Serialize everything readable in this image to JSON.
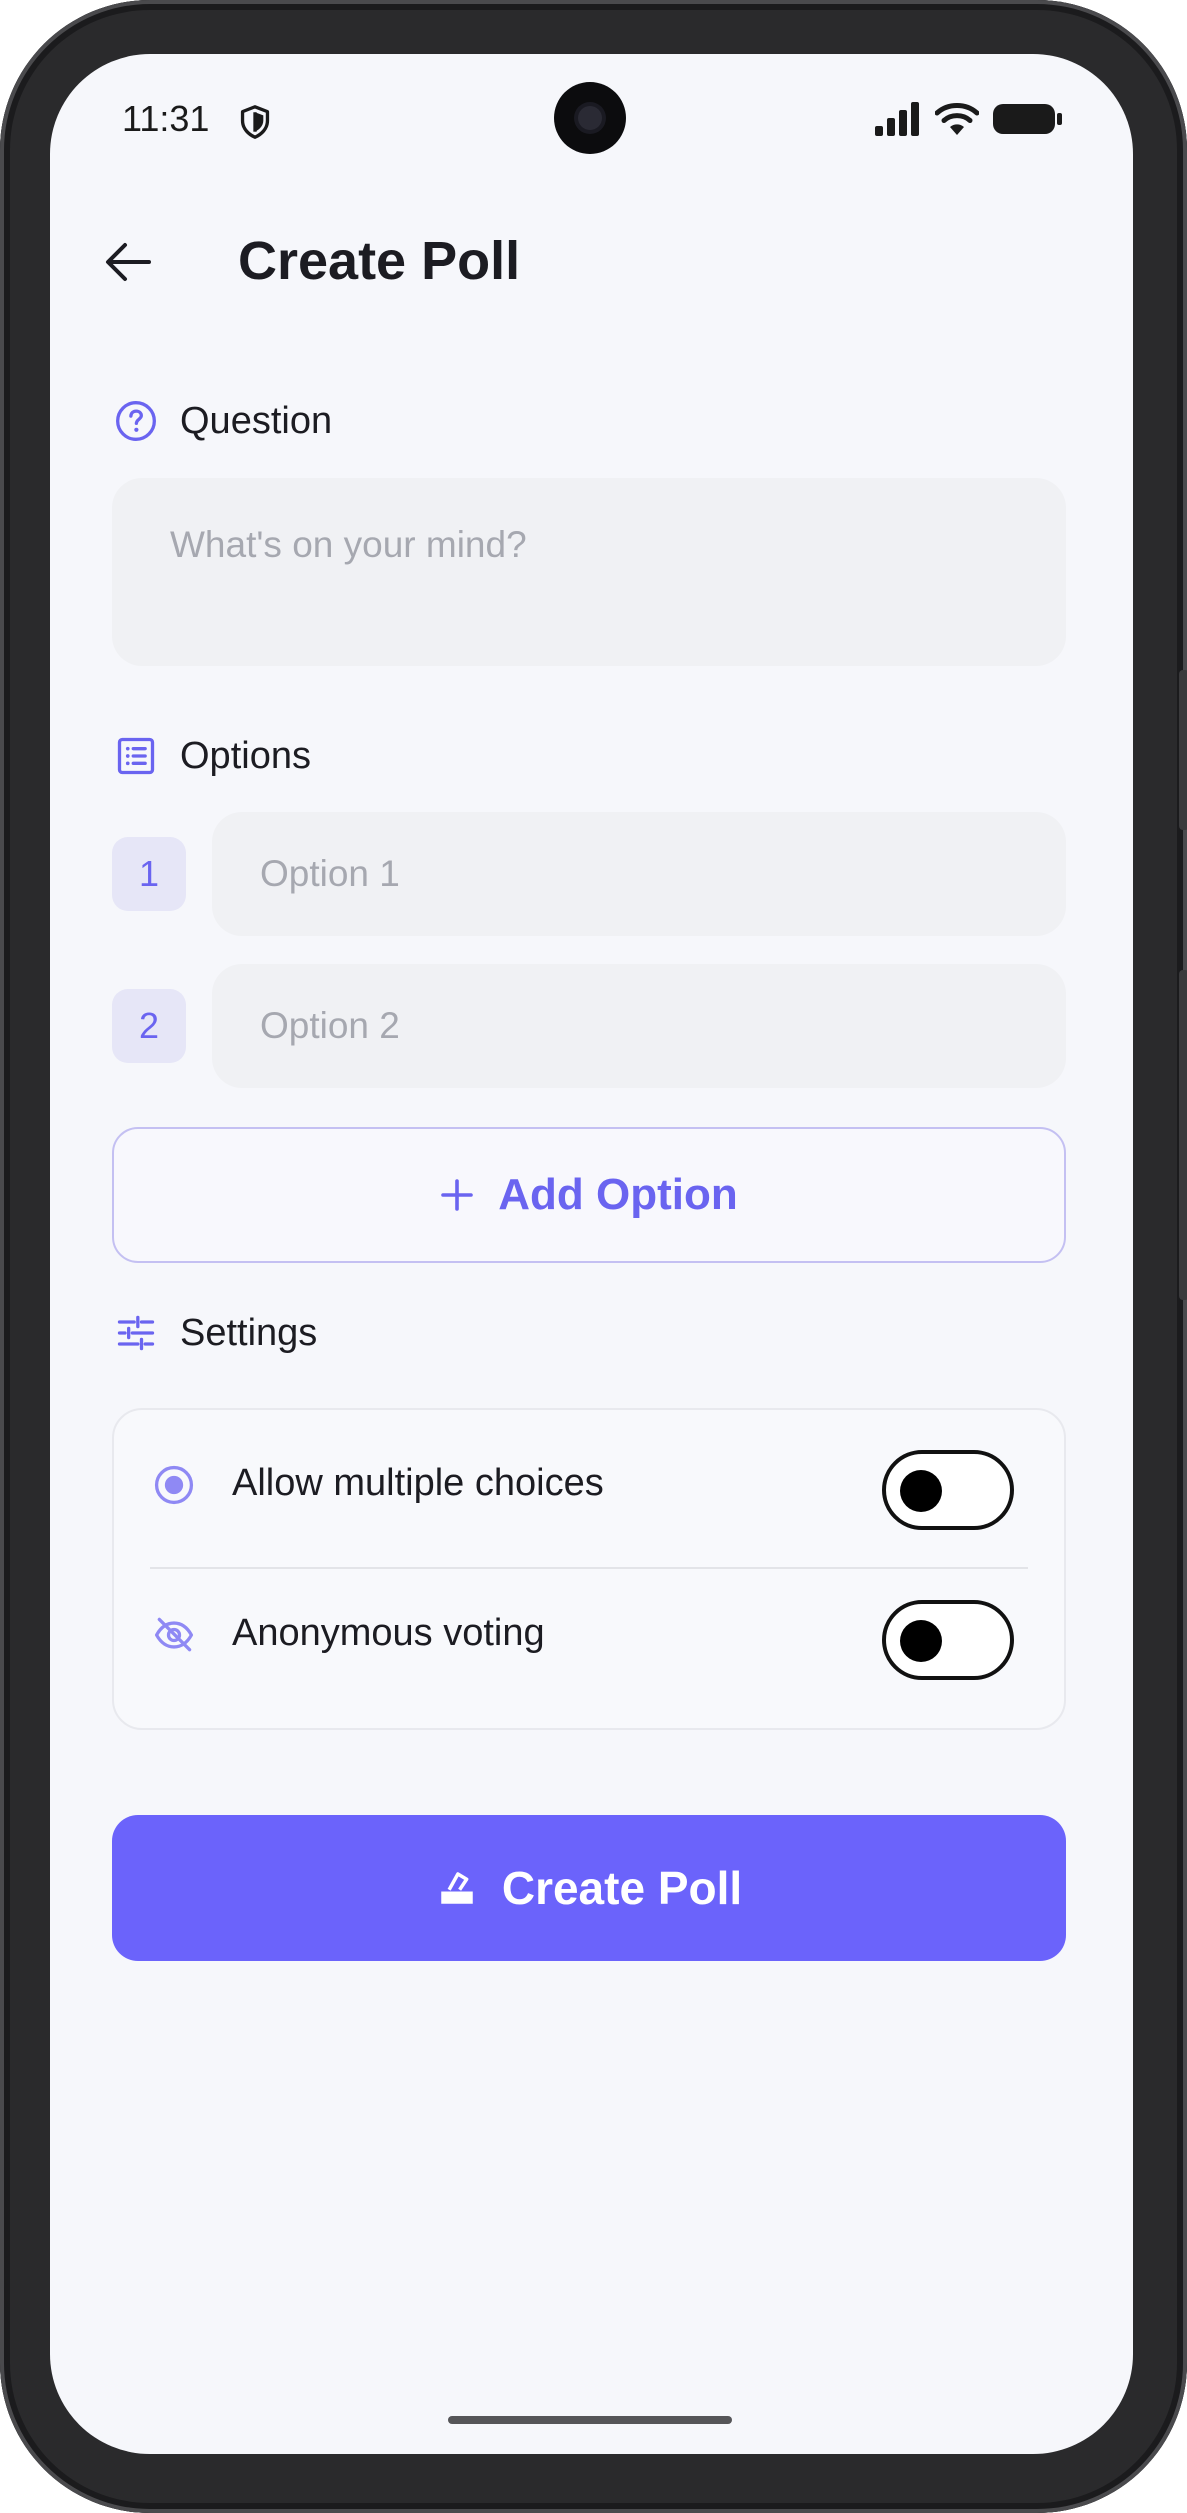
{
  "status_bar": {
    "time": "11:31"
  },
  "header": {
    "title": "Create Poll"
  },
  "question": {
    "label": "Question",
    "placeholder": "What's on your mind?",
    "value": ""
  },
  "options": {
    "label": "Options",
    "items": [
      {
        "number": "1",
        "placeholder": "Option 1",
        "value": ""
      },
      {
        "number": "2",
        "placeholder": "Option 2",
        "value": ""
      }
    ],
    "add_label": "Add Option"
  },
  "settings": {
    "label": "Settings",
    "items": [
      {
        "label": "Allow multiple choices",
        "enabled": false
      },
      {
        "label": "Anonymous voting",
        "enabled": false
      }
    ]
  },
  "submit": {
    "label": "Create Poll"
  },
  "colors": {
    "accent": "#6b63fb",
    "accent_text": "#6a64f0",
    "background": "#f6f7fb",
    "field": "#f0f1f4"
  }
}
